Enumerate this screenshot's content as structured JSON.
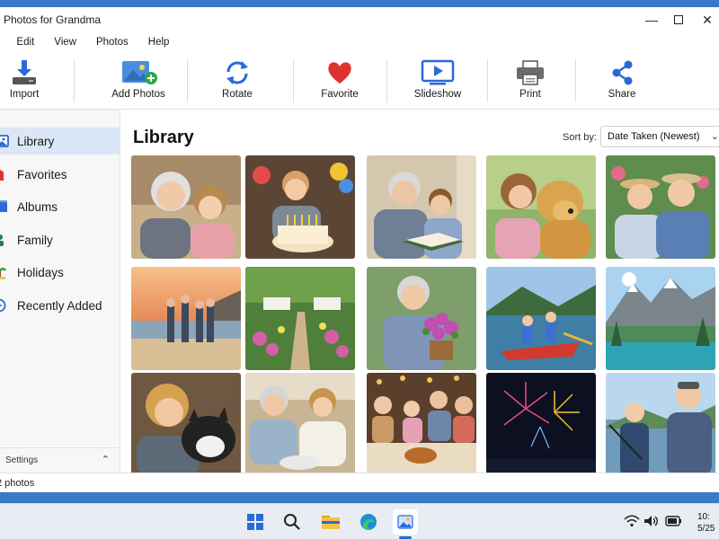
{
  "window": {
    "title": "Photos for Grandma",
    "controls": {
      "minimize": "—",
      "maximize": "☐",
      "close": "✕"
    }
  },
  "menu": [
    "e",
    "Edit",
    "View",
    "Photos",
    "Help"
  ],
  "toolbar": [
    {
      "label": "Import",
      "icon": "import-icon"
    },
    {
      "label": "Add Photos",
      "icon": "add-photos-icon"
    },
    {
      "label": "Rotate",
      "icon": "rotate-icon"
    },
    {
      "label": "Favorite",
      "icon": "heart-icon"
    },
    {
      "label": "Slideshow",
      "icon": "slideshow-icon"
    },
    {
      "label": "Print",
      "icon": "printer-icon"
    },
    {
      "label": "Share",
      "icon": "share-icon"
    }
  ],
  "sidebar": {
    "items": [
      {
        "label": "Library",
        "icon": "library-icon",
        "active": true
      },
      {
        "label": "Favorites",
        "icon": "heart-icon"
      },
      {
        "label": "Albums",
        "icon": "albums-icon"
      },
      {
        "label": "Family",
        "icon": "family-icon"
      },
      {
        "label": "Holidays",
        "icon": "palm-tree-icon"
      },
      {
        "label": "Recently Added",
        "icon": "clock-icon"
      }
    ],
    "footer": {
      "label": "Settings",
      "chevron": "⌃"
    }
  },
  "main": {
    "title": "Library",
    "sort": {
      "label": "Sort by:",
      "value": "Date Taken (Newest)"
    },
    "photos": [
      {
        "caption": "Grandmother hugging granddaughter"
      },
      {
        "caption": "Boy blowing birthday candles"
      },
      {
        "caption": "Grandfather reading to grandson"
      },
      {
        "caption": "Girl hugging golden retriever"
      },
      {
        "caption": "Elderly couple in garden"
      },
      {
        "caption": "Family on the beach at sunset"
      },
      {
        "caption": "Garden path with flowers"
      },
      {
        "caption": "Grandmother holding flower pot"
      },
      {
        "caption": "Boys in a canoe on a lake"
      },
      {
        "caption": "Mountain lake landscape"
      },
      {
        "caption": "Child hugging a cat"
      },
      {
        "caption": "Baking with grandma"
      },
      {
        "caption": "Family dinner"
      },
      {
        "caption": "Fireworks over water"
      },
      {
        "caption": "Fishing with grandpa"
      }
    ]
  },
  "status": {
    "text": "2 photos"
  },
  "taskbar": {
    "apps": [
      "windows-start-icon",
      "search-icon",
      "file-explorer-icon",
      "edge-browser-icon",
      "photos-app-icon"
    ],
    "tray": [
      "wifi-icon",
      "volume-icon",
      "battery-icon"
    ],
    "clock": {
      "time": "10:",
      "date": "5/25"
    }
  },
  "colors": {
    "accent": "#2a6ad8",
    "selected": "#dbe7f6",
    "heart": "#e03131"
  }
}
